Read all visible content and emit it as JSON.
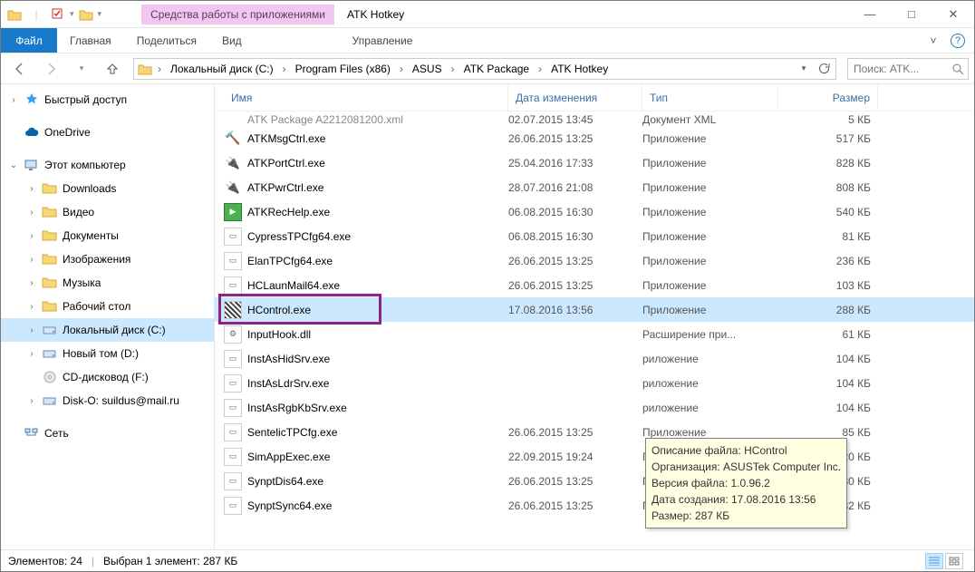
{
  "title": "ATK Hotkey",
  "tool_tab": "Средства работы с приложениями",
  "ribbon": {
    "file": "Файл",
    "tabs": [
      "Главная",
      "Поделиться",
      "Вид"
    ],
    "tool": "Управление"
  },
  "breadcrumbs": [
    "Локальный диск (C:)",
    "Program Files (x86)",
    "ASUS",
    "ATK Package",
    "ATK Hotkey"
  ],
  "search_placeholder": "Поиск: ATK...",
  "columns": {
    "name": "Имя",
    "date": "Дата изменения",
    "type": "Тип",
    "size": "Размер"
  },
  "tree": [
    {
      "label": "Быстрый доступ",
      "icon": "star",
      "tw": ">",
      "indent": 0
    },
    {
      "label": "OneDrive",
      "icon": "cloud",
      "tw": "",
      "indent": 0
    },
    {
      "label": "Этот компьютер",
      "icon": "pc",
      "tw": "v",
      "indent": 0
    },
    {
      "label": "Downloads",
      "icon": "folder",
      "tw": ">",
      "indent": 1
    },
    {
      "label": "Видео",
      "icon": "folder",
      "tw": ">",
      "indent": 1
    },
    {
      "label": "Документы",
      "icon": "folder",
      "tw": ">",
      "indent": 1
    },
    {
      "label": "Изображения",
      "icon": "folder",
      "tw": ">",
      "indent": 1
    },
    {
      "label": "Музыка",
      "icon": "folder",
      "tw": ">",
      "indent": 1
    },
    {
      "label": "Рабочий стол",
      "icon": "folder",
      "tw": ">",
      "indent": 1
    },
    {
      "label": "Локальный диск (C:)",
      "icon": "drive",
      "tw": ">",
      "indent": 1,
      "sel": true
    },
    {
      "label": "Новый том (D:)",
      "icon": "drive",
      "tw": ">",
      "indent": 1
    },
    {
      "label": "CD-дисковод (F:)",
      "icon": "cd",
      "tw": "",
      "indent": 1
    },
    {
      "label": "Disk-O: suildus@mail.ru",
      "icon": "drive",
      "tw": ">",
      "indent": 1
    },
    {
      "label": "Сеть",
      "icon": "net",
      "tw": "",
      "indent": 0
    }
  ],
  "toprow": {
    "name": "ATK Package A2212081200.xml",
    "date": "02.07.2015 13:45",
    "type": "Документ XML",
    "size": "5 КБ"
  },
  "files": [
    {
      "name": "ATKMsgCtrl.exe",
      "date": "26.06.2015 13:25",
      "type": "Приложение",
      "size": "517 КБ",
      "icon": "hammer"
    },
    {
      "name": "ATKPortCtrl.exe",
      "date": "25.04.2016 17:33",
      "type": "Приложение",
      "size": "828 КБ",
      "icon": "plug"
    },
    {
      "name": "ATKPwrCtrl.exe",
      "date": "28.07.2016 21:08",
      "type": "Приложение",
      "size": "808 КБ",
      "icon": "plug"
    },
    {
      "name": "ATKRecHelp.exe",
      "date": "06.08.2015 16:30",
      "type": "Приложение",
      "size": "540 КБ",
      "icon": "green"
    },
    {
      "name": "CypressTPCfg64.exe",
      "date": "06.08.2015 16:30",
      "type": "Приложение",
      "size": "81 КБ",
      "icon": "app"
    },
    {
      "name": "ElanTPCfg64.exe",
      "date": "26.06.2015 13:25",
      "type": "Приложение",
      "size": "236 КБ",
      "icon": "app"
    },
    {
      "name": "HCLaunMail64.exe",
      "date": "26.06.2015 13:25",
      "type": "Приложение",
      "size": "103 КБ",
      "icon": "app"
    },
    {
      "name": "HControl.exe",
      "date": "17.08.2016 13:56",
      "type": "Приложение",
      "size": "288 КБ",
      "icon": "hcontrol",
      "sel": true
    },
    {
      "name": "InputHook.dll",
      "date": "",
      "type": "Расширение при...",
      "size": "61 КБ",
      "icon": "dll"
    },
    {
      "name": "InstAsHidSrv.exe",
      "date": "",
      "type": "риложение",
      "size": "104 КБ",
      "icon": "app"
    },
    {
      "name": "InstAsLdrSrv.exe",
      "date": "",
      "type": "риложение",
      "size": "104 КБ",
      "icon": "app"
    },
    {
      "name": "InstAsRgbKbSrv.exe",
      "date": "",
      "type": "риложение",
      "size": "104 КБ",
      "icon": "app"
    },
    {
      "name": "SentelicTPCfg.exe",
      "date": "26.06.2015 13:25",
      "type": "Приложение",
      "size": "85 КБ",
      "icon": "app"
    },
    {
      "name": "SimAppExec.exe",
      "date": "22.09.2015 19:24",
      "type": "Приложение",
      "size": "120 КБ",
      "icon": "app"
    },
    {
      "name": "SynptDis64.exe",
      "date": "26.06.2015 13:25",
      "type": "Приложение",
      "size": "80 КБ",
      "icon": "app"
    },
    {
      "name": "SynptSync64.exe",
      "date": "26.06.2015 13:25",
      "type": "Приложение",
      "size": "82 КБ",
      "icon": "app"
    }
  ],
  "tooltip": {
    "l1": "Описание файла: HControl",
    "l2": "Организация: ASUSTek Computer Inc.",
    "l3": "Версия файла: 1.0.96.2",
    "l4": "Дата создания: 17.08.2016 13:56",
    "l5": "Размер: 287 КБ"
  },
  "status": {
    "items": "Элементов: 24",
    "selected": "Выбран 1 элемент: 287 КБ"
  }
}
